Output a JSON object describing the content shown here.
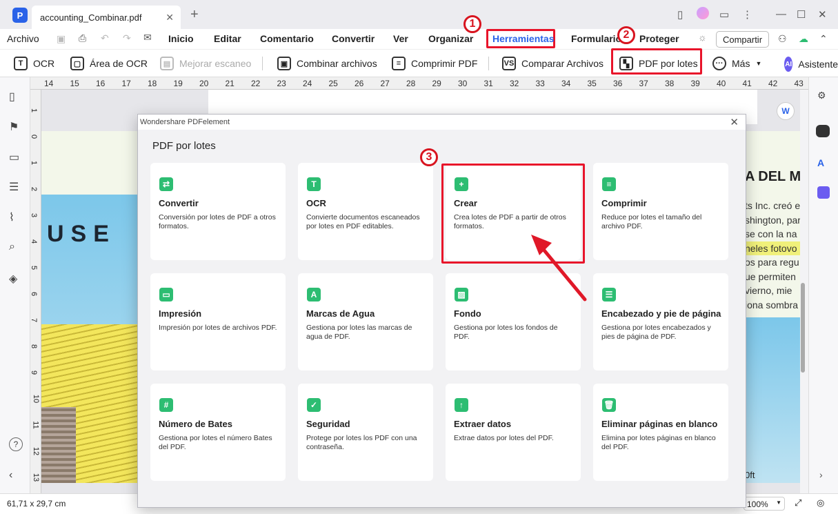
{
  "app": {
    "tab_title": "accounting_Combinar.pdf",
    "logo_letter": "P"
  },
  "menu": {
    "items": [
      "Archivo",
      "Inicio",
      "Editar",
      "Comentario",
      "Convertir",
      "Ver",
      "Organizar",
      "Herramientas",
      "Formulario",
      "Proteger"
    ],
    "share": "Compartir"
  },
  "toolbar": {
    "ocr": "OCR",
    "ocr_area": "Área de OCR",
    "improve_scan": "Mejorar escaneo",
    "combine": "Combinar archivos",
    "compress": "Comprimir PDF",
    "compare": "Comparar Archivos",
    "batch": "PDF por lotes",
    "more": "Más",
    "assistant": "Asistente"
  },
  "annotations": {
    "n1": "1",
    "n2": "2",
    "n3": "3"
  },
  "ruler": {
    "h": [
      "14",
      "15",
      "16",
      "17",
      "18",
      "19",
      "20",
      "21",
      "22",
      "23",
      "24",
      "25",
      "26",
      "27",
      "28",
      "29",
      "30",
      "31",
      "32",
      "33",
      "34",
      "35",
      "36",
      "37",
      "38",
      "39",
      "40",
      "41",
      "42",
      "43"
    ],
    "v": [
      "1",
      "0",
      "1",
      "2",
      "3",
      "4",
      "5",
      "6",
      "7",
      "8",
      "9",
      "10",
      "11",
      "12",
      "13"
    ]
  },
  "document": {
    "left_text": "USE",
    "right_heading": "A DEL M",
    "right_lines": [
      "ts Inc. creó e",
      "shington, para",
      "se con la na",
      "neles fotovo",
      "os para regu",
      "ue permiten",
      "vierno, mie",
      "iona sombra"
    ],
    "bottom_fragment": "0ft"
  },
  "dialog": {
    "window_title": "Wondershare PDFelement",
    "heading": "PDF por lotes",
    "cards": [
      {
        "icon": "convert-icon",
        "glyph": "⇄",
        "title": "Convertir",
        "desc": "Conversión por lotes de PDF a otros formatos."
      },
      {
        "icon": "ocr-icon",
        "glyph": "T",
        "title": "OCR",
        "desc": "Convierte documentos escaneados por lotes en PDF editables."
      },
      {
        "icon": "create-icon",
        "glyph": "+",
        "title": "Crear",
        "desc": "Crea lotes de PDF a partir de otros formatos."
      },
      {
        "icon": "compress-icon",
        "glyph": "≡",
        "title": "Comprimir",
        "desc": "Reduce por lotes el tamaño del archivo PDF."
      },
      {
        "icon": "print-icon",
        "glyph": "▭",
        "title": "Impresión",
        "desc": "Impresión por lotes de archivos PDF."
      },
      {
        "icon": "watermark-icon",
        "glyph": "A",
        "title": "Marcas de Agua",
        "desc": "Gestiona por lotes las marcas de agua de PDF."
      },
      {
        "icon": "background-icon",
        "glyph": "▨",
        "title": "Fondo",
        "desc": "Gestiona por lotes los fondos de PDF."
      },
      {
        "icon": "header-footer-icon",
        "glyph": "☰",
        "title": "Encabezado y pie de página",
        "desc": "Gestiona por lotes encabezados y pies de página de PDF."
      },
      {
        "icon": "bates-icon",
        "glyph": "#",
        "title": "Número de Bates",
        "desc": "Gestiona por lotes el número Bates del PDF."
      },
      {
        "icon": "security-icon",
        "glyph": "✓",
        "title": "Seguridad",
        "desc": "Protege por lotes los PDF con una contraseña."
      },
      {
        "icon": "extract-icon",
        "glyph": "↑",
        "title": "Extraer datos",
        "desc": "Extrae datos por lotes del PDF."
      },
      {
        "icon": "delete-blank-icon",
        "glyph": "🗑",
        "title": "Eliminar páginas en blanco",
        "desc": "Elimina por lotes páginas en blanco del PDF."
      }
    ]
  },
  "status": {
    "dimensions": "61,71 x 29,7 cm",
    "zoom": "100%"
  },
  "colors": {
    "accent": "#2a62e8",
    "highlight": "#e8142a",
    "card_icon": "#2dbd72"
  }
}
